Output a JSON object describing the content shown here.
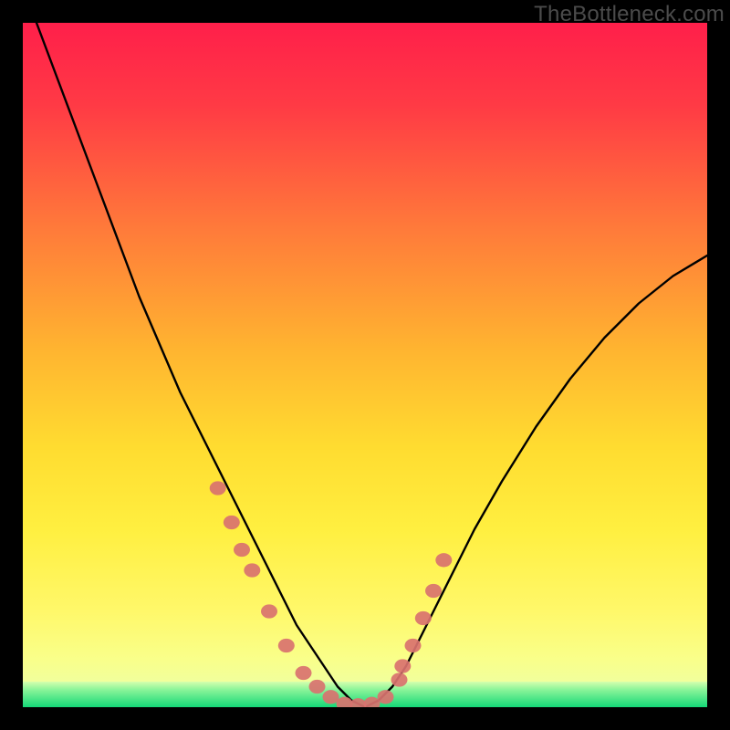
{
  "watermark": "TheBottleneck.com",
  "chart_data": {
    "type": "line",
    "title": "",
    "xlabel": "",
    "ylabel": "",
    "xlim": [
      0,
      100
    ],
    "ylim": [
      0,
      100
    ],
    "grid": false,
    "legend": false,
    "background_gradient": {
      "top_color": "#ff1f4a",
      "mid_colors": [
        "#ff6a3a",
        "#ffc531",
        "#ffe531",
        "#fff75a"
      ],
      "bottom_band_color": "#14e07a"
    },
    "series": [
      {
        "name": "bottleneck-curve",
        "type": "line",
        "color": "#000000",
        "x": [
          2,
          5,
          8,
          11,
          14,
          17,
          20,
          23,
          26,
          28,
          30,
          32,
          34,
          36,
          38,
          40,
          42,
          44,
          46,
          48,
          50,
          52,
          54,
          56,
          58,
          60,
          63,
          66,
          70,
          75,
          80,
          85,
          90,
          95,
          100
        ],
        "y": [
          100,
          92,
          84,
          76,
          68,
          60,
          53,
          46,
          40,
          36,
          32,
          28,
          24,
          20,
          16,
          12,
          9,
          6,
          3,
          1,
          0,
          1,
          3,
          6,
          10,
          14,
          20,
          26,
          33,
          41,
          48,
          54,
          59,
          63,
          66
        ]
      },
      {
        "name": "salmon-markers",
        "type": "scatter",
        "color": "#d9726f",
        "marker_radius": 9,
        "x": [
          28.5,
          30.5,
          32.0,
          33.5,
          36.0,
          38.5,
          41.0,
          43.0,
          45.0,
          47.0,
          49.0,
          51.0,
          53.0,
          55.0,
          55.5,
          57.0,
          58.5,
          60.0,
          61.5
        ],
        "y": [
          32.0,
          27.0,
          23.0,
          20.0,
          14.0,
          9.0,
          5.0,
          3.0,
          1.5,
          0.5,
          0.3,
          0.5,
          1.5,
          4.0,
          6.0,
          9.0,
          13.0,
          17.0,
          21.5
        ]
      }
    ],
    "bottom_band": {
      "y_from": 0,
      "y_to": 3,
      "color": "#14e07a"
    }
  }
}
